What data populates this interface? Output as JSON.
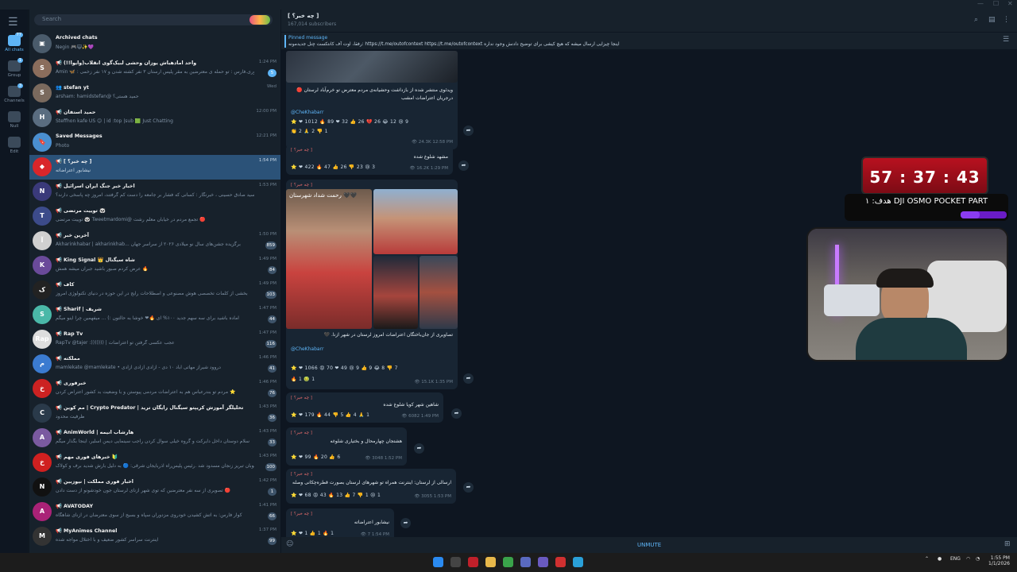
{
  "search_placeholder": "Search",
  "folders": [
    {
      "label": "All chats",
      "count": "77"
    },
    {
      "label": "Group",
      "count": "1"
    },
    {
      "label": "Channels",
      "count": "3"
    },
    {
      "label": "Null",
      "count": ""
    },
    {
      "label": "Edit",
      "count": ""
    }
  ],
  "chats": [
    {
      "name": "Archived chats",
      "preview": "Negin 🎮😺✨💜",
      "time": "",
      "badge": "",
      "avatar": "▣",
      "color": "#4a5b6b"
    },
    {
      "name": "📢 واحد امادهباش یوزان وحشی لبیک‌گوی انقلاب(وایوا!!)",
      "preview": "Amin 🦋 : فوری.فارس : تو حمله ی معترضین به مقر پلیس ارستان ۳ نفر کشته شدن و ۱۷ نفر زخمی",
      "time": "1:24 PM",
      "badge": "5",
      "avatar": "S",
      "color": "#8a6d5c"
    },
    {
      "name": "👥 stefan yt",
      "preview": "arsham: hamidstefan@ حمید هستی؟",
      "time": "Wed",
      "badge": "",
      "avatar": "S",
      "color": "#7a6a5e"
    },
    {
      "name": "📢 حمید استفان",
      "preview": "Steffhon kafe US 😊 | id :top |sub 🟩 Just Chatting",
      "time": "12:00 PM",
      "badge": "",
      "avatar": "H",
      "color": "#5a6d80"
    },
    {
      "name": "Saved Messages",
      "preview": "Photo",
      "time": "12:21 PM",
      "badge": "",
      "avatar": "🔖",
      "color": "#4a8fd0"
    },
    {
      "name": "📢 [ چه خبر؟ ]",
      "preview": "نیشابور اعتراضاته",
      "time": "1:54 PM",
      "badge": "",
      "avatar": "◆",
      "color": "#d9262a"
    },
    {
      "name": "📢 اخبار خبر جنگ ایران اسرائیل",
      "preview": "سید صادق حسینی ، خبرنگار : کسانی که فشار بر جامعه را دست کم گرفتند، امروز چه پاسخی دارند؟",
      "time": "1:53 PM",
      "badge": "",
      "avatar": "N",
      "color": "#3a3a7a"
    },
    {
      "name": "📢 توییت مرتضی 🐼",
      "preview": "توییت مرتضی 🐼 Tweetmardomi@ تجمع مردم در خیابان معلم رشت 🔴",
      "time": "",
      "badge": "",
      "avatar": "T",
      "color": "#3c4b8a"
    },
    {
      "name": "📢 آخرین خبر",
      "preview": "Akharinkhabar | akharinkhab... برگزیده جشن‌های سال نو میلادی ۲۰۲۶ از سراسر جهان",
      "time": "1:50 PM",
      "badge": "859",
      "avatar": "آ",
      "color": "#d0d0d0"
    },
    {
      "name": "📢 King Signal 👑 شاه سیگنال",
      "preview": "عرض کردم صبور باشید جبران میشه همش 🔥",
      "time": "1:49 PM",
      "badge": "84",
      "avatar": "K",
      "color": "#6a4a9a"
    },
    {
      "name": "📢 کاف",
      "preview": "بخشی از کلمات تخصصی هوش مصنوعی و اصطلاحات رایج در این حوزه در دنیای تکنولوژی امروز",
      "time": "1:49 PM",
      "badge": "103",
      "avatar": "ک",
      "color": "#222222"
    },
    {
      "name": "📢 Sharif | شریف",
      "preview": "آماده باشید برای سه سهم جدید ۱۰۰% ای 🔥❤ خوشا به حالتون :) ... میفهمین چرا اینو میگم",
      "time": "1:47 PM",
      "badge": "44",
      "avatar": "S",
      "color": "#4ab8a8"
    },
    {
      "name": "📢 Rap Tv",
      "preview": "RapTv @tajer :))))))) | عجب عکسی گرفتن تو اعتراضات",
      "time": "1:47 PM",
      "badge": "116",
      "avatar": "Rap",
      "color": "#dddddd"
    },
    {
      "name": "📢 مملکته",
      "preview": "mamlekate @mamlekate • دروود شیراز مهاتی اباد ۱۰ دی - آزادی آزادی آزادی",
      "time": "1:46 PM",
      "badge": "41",
      "avatar": "م",
      "color": "#3b7bd0"
    },
    {
      "name": "📢 خبرفوری",
      "preview": "مردم تو بندرعباس هم به اعتراضات مردمی پیوستن و با وضعیت بد کشور اعتراض کردن ⭐",
      "time": "1:46 PM",
      "badge": "76",
      "avatar": "خ",
      "color": "#cc2222"
    },
    {
      "name": "📢 مم کوین | Crypto Predator | تحلیلگر آموزش کریپتو سیگنال رایگان ترید",
      "preview": "ظرفیت محدود",
      "time": "1:43 PM",
      "badge": "36",
      "avatar": "C",
      "color": "#2a3a4a"
    },
    {
      "name": "📢 AnimWorld | هارشاب انیمه",
      "preview": "سلام دوستان داخل دایرکت و گروه خیلی سوال کردن راجب سینمایی دیمن اسلیر، اینجا بگذار میگم",
      "time": "1:43 PM",
      "badge": "33",
      "avatar": "A",
      "color": "#7a5aa0"
    },
    {
      "name": "📢 خبرهای فوری مهم 🔰",
      "preview": "کوبان تبریز زنجان مسدود شد .رئیس پلیس‌راه آذربایجان شرقی: 🔵 به دلیل بارش شدید برف و کولاک",
      "time": "1:43 PM",
      "badge": "100",
      "avatar": "خ",
      "color": "#d02020"
    },
    {
      "name": "📢 اخبار فوری مملکت | نیوزبین",
      "preview": "تصویری از سه نفر معترضین که توی شهر ازنای لرستان جون خودشونو از دست دادن 🔴",
      "time": "1:42 PM",
      "badge": "1",
      "avatar": "N",
      "color": "#111111"
    },
    {
      "name": "📢 AVATODAY",
      "preview": "کوار فارس: به آتش کشیدن خودروی مزدوران سپاه و بسیج از سوی معترضان در ازنای شاهگاه",
      "time": "1:41 PM",
      "badge": "66",
      "avatar": "A",
      "color": "#aa2277"
    },
    {
      "name": "📢 MyAnimes Channel",
      "preview": "اینترنت سراسر کشور ضعیف و با اختلال مواجه شده",
      "time": "1:37 PM",
      "badge": "99",
      "avatar": "M",
      "color": "#333333"
    }
  ],
  "channel": {
    "title": "[ چه خبر؟ ]",
    "subscribers": "167,014 subscribers"
  },
  "pinned": {
    "label": "Pinned message",
    "text": "رفقا، اوت آف کانتکست چنل جدیدمونه: https://t.me/outofcontext https://t.me/outofcontext  اینجا چیزایی ارسال میشه که هیچ کیشی برای توضیح دادنش وجود نداره"
  },
  "messages": [
    {
      "sender": "",
      "text1": "ویدئوی منتشر شده از بازداشت وحشیانه‌ی مردم معترض تو خرم‌آباد لرستان 🔴",
      "text2": "درجریان اعتراضات امشب",
      "link": "@CheKhabarr",
      "reactions1": "⭐ ❤ 1012  🔥 89  ❤ 32  👍 26  💔 26  😂 12  😢 9",
      "reactions2": "👏 2  🙏 2  👎 1",
      "views": "24.3K",
      "time": "12:58 PM"
    },
    {
      "sender": "[ چه خبر؟ ]",
      "text1": "مشهد شلوغ شده",
      "reactions1": "⭐ ❤ 422  🔥 47  👍 26  👎 23  😢 3",
      "views": "16.2K",
      "time": "1:29 PM"
    },
    {
      "sender": "[ چه خبر؟ ]",
      "text1": "تصاویری از جان‌باختگان اعتراضات امروز لرستان در شهر ازنا. 🖤",
      "link": "@CheKhabarr",
      "reactions1": "⭐ ❤ 1066  😡 70  ❤ 49  😢 9  👍 9  😂 8  👎 7",
      "reactions2": "🔥 1  🤢 1",
      "views": "15.1K",
      "time": "1:35 PM",
      "overlay": "رحمت شداد شهرستان 🖤🖤"
    },
    {
      "sender": "[ چه خبر؟ ]",
      "text1": "شاهین شهر کویا شلوغ شده",
      "reactions1": "⭐ ❤ 179  🔥 44  👎 5  👍 4  🙏 1",
      "views": "6082",
      "time": "1:49 PM"
    },
    {
      "sender": "[ چه خبر؟ ]",
      "text1": "هشتجان چهارمحال و بختیاری شلوغه",
      "reactions1": "⭐ ❤ 99  🔥 20  👍 6",
      "views": "3048",
      "time": "1:52 PM"
    },
    {
      "sender": "[ چه خبر؟ ]",
      "text1": "ارسالی از لرستان: اینترنت همراه تو شهرهای لرستان بصورت قطره‌چکانی وصله",
      "reactions1": "⭐ ❤ 68  😡 43  🔥 13  👍 7  👎 1  😢 1",
      "views": "3055",
      "time": "1:53 PM"
    },
    {
      "sender": "[ چه خبر؟ ]",
      "text1": "نیشابور اعتراضاته",
      "reactions1": "⭐ ❤ 1  👍 1  🔥 1",
      "views": "7",
      "time": "1:54 PM"
    }
  ],
  "composer": {
    "unmute": "UNMUTE"
  },
  "stream": {
    "timer": "57 : 37 : 43",
    "goal": "هدف: ۱ DJI OSMO POCKET PART",
    "goal_progress": 0.42
  },
  "tray": {
    "lang": "ENG",
    "time": "1:55 PM",
    "date": "1/1/2026"
  },
  "colors": {
    "accent": "#5eb5f7",
    "active_chat": "#2b5278",
    "timer": "#b8111f"
  }
}
